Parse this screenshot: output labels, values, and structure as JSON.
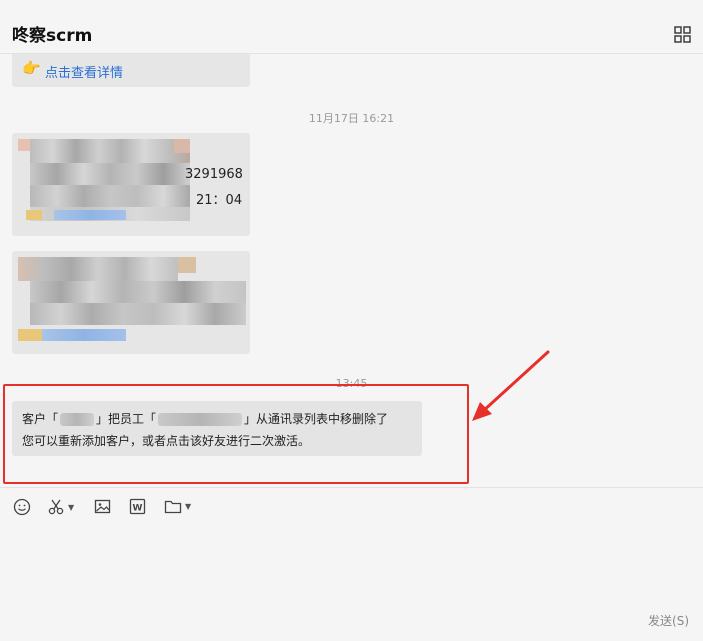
{
  "app": {
    "title": "咚察scrm"
  },
  "messages": {
    "link_bubble": {
      "icon": "pointing-hand-icon",
      "link_text": "点击查看详情"
    },
    "timestamp_1": "11月17日 16:21",
    "card1": {
      "visible_number": "3291968",
      "visible_time": "21：04"
    },
    "timestamp_2": "13:45",
    "system_notice": {
      "part1": "客户「",
      "part2": "」把员工「",
      "part3": "」从通讯录列表中移删除了",
      "line2": "您可以重新添加客户，或者点击该好友进行二次激活。"
    }
  },
  "toolbar": {
    "items": [
      "emoji-icon",
      "scissors-icon",
      "image-icon",
      "word-doc-icon",
      "folder-icon"
    ]
  },
  "input": {
    "send_label": "发送(S)"
  },
  "colors": {
    "link": "#2a6fd6",
    "annotation_red": "#e8302a",
    "bubble_bg": "#e6e6e6"
  }
}
